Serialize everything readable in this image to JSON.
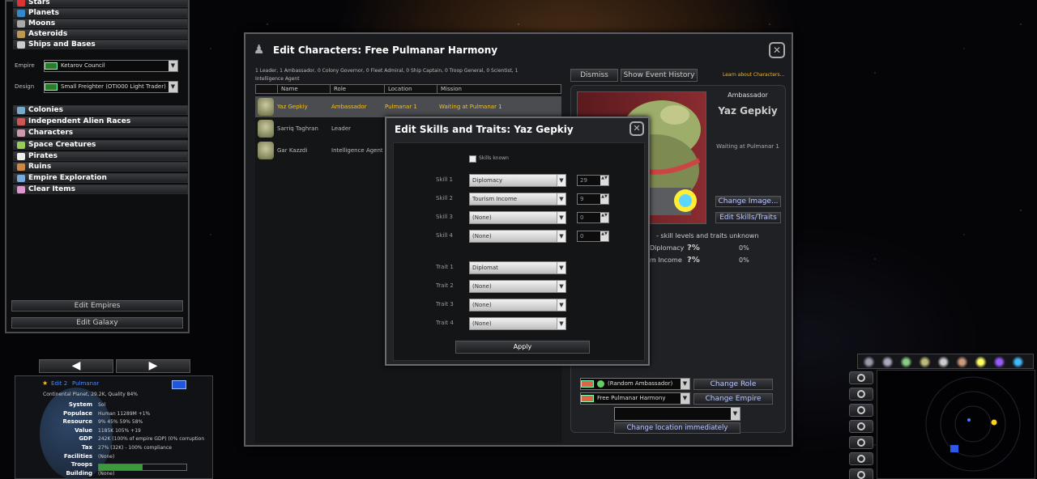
{
  "left_panel": {
    "items_top": [
      {
        "label": "Stars",
        "color": "#d33"
      },
      {
        "label": "Planets",
        "color": "#38c"
      },
      {
        "label": "Moons",
        "color": "#aaa"
      },
      {
        "label": "Asteroids",
        "color": "#b95"
      },
      {
        "label": "Ships and Bases",
        "color": "#ccc"
      }
    ],
    "empire_label": "Empire",
    "empire_value": "Ketarov Council",
    "design_label": "Design",
    "design_value": "Small Freighter (OTI000 Light Trader)",
    "items_bottom": [
      {
        "label": "Colonies",
        "color": "#7ac"
      },
      {
        "label": "Independent Alien Races",
        "color": "#c55"
      },
      {
        "label": "Characters",
        "color": "#c9a"
      },
      {
        "label": "Space Creatures",
        "color": "#9c5"
      },
      {
        "label": "Pirates",
        "color": "#eee"
      },
      {
        "label": "Ruins",
        "color": "#c84"
      },
      {
        "label": "Empire Exploration",
        "color": "#7ad"
      },
      {
        "label": "Clear Items",
        "color": "#d9c"
      }
    ],
    "edit_empires": "Edit Empires",
    "edit_galaxy": "Edit Galaxy"
  },
  "main": {
    "title": "Edit Characters: Free Pulmanar Harmony",
    "summary": "1 Leader, 1 Ambassador, 0 Colony Governor, 0 Fleet Admiral, 0 Ship Captain, 0 Troop General, 0 Scientist, 1 Intelligence Agent",
    "columns": [
      "Name",
      "Role",
      "Location",
      "Mission"
    ],
    "rows": [
      {
        "name": "Yaz Gepkiy",
        "role": "Ambassador",
        "location": "Pulmanar 1",
        "mission": "Waiting at Pulmanar 1"
      },
      {
        "name": "Sarriq Taghran",
        "role": "Leader",
        "location": "",
        "mission": ""
      },
      {
        "name": "Gar Kazzdi",
        "role": "Intelligence Agent",
        "location": "",
        "mission": ""
      }
    ],
    "dismiss": "Dismiss",
    "show_event_history": "Show Event History",
    "learn_link": "Learn about Characters...",
    "detail_role": "Ambassador",
    "detail_name": "Yaz Gepkiy",
    "detail_status": "Waiting at Pulmanar 1",
    "change_image": "Change Image...",
    "edit_skills_traits": "Edit Skills/Traits",
    "skills_note": "- skill levels and traits unknown",
    "skill_rows": [
      {
        "label": "Diplomacy",
        "level": "?%",
        "value": "0%"
      },
      {
        "label": "m Income",
        "level": "?%",
        "value": "0%"
      }
    ],
    "role_select": "(Random Ambassador)",
    "change_role": "Change Role",
    "empire_select": "Free Pulmanar Harmony",
    "change_empire": "Change Empire",
    "location_select": "",
    "change_location": "Change location immediately"
  },
  "dialog": {
    "title": "Edit Skills and Traits: Yaz Gepkiy",
    "skills_known": "Skills known",
    "skills": [
      {
        "label": "Skill 1",
        "value": "Diplomacy",
        "level": "29"
      },
      {
        "label": "Skill 2",
        "value": "Tourism Income",
        "level": "9"
      },
      {
        "label": "Skill 3",
        "value": "(None)",
        "level": "0"
      },
      {
        "label": "Skill 4",
        "value": "(None)",
        "level": "0"
      }
    ],
    "traits": [
      {
        "label": "Trait 1",
        "value": "Diplomat"
      },
      {
        "label": "Trait 2",
        "value": "(None)"
      },
      {
        "label": "Trait 3",
        "value": "(None)"
      },
      {
        "label": "Trait 4",
        "value": "(None)"
      }
    ],
    "apply": "Apply"
  },
  "system_panel": {
    "name": "Edit 2",
    "name_suffix": "Pulmanar",
    "desc": "Continental Planet, 29.2K, Quality 84%",
    "fields": [
      {
        "label": "System",
        "value": "Sol"
      },
      {
        "label": "Populace",
        "value": "Human   11289M   +1%"
      },
      {
        "label": "Resource",
        "value": "9%   45%   59%   58%"
      },
      {
        "label": "Value",
        "value": "1185K   105%   +19"
      },
      {
        "label": "GDP",
        "value": "242K (100% of empire GDP) (0% corruption"
      },
      {
        "label": "Tax",
        "value": "27% (32K) - 100% compliance"
      },
      {
        "label": "Facilities",
        "value": "(None)"
      },
      {
        "label": "Troops",
        "value": ""
      },
      {
        "label": "Building",
        "value": "(None)"
      }
    ]
  }
}
